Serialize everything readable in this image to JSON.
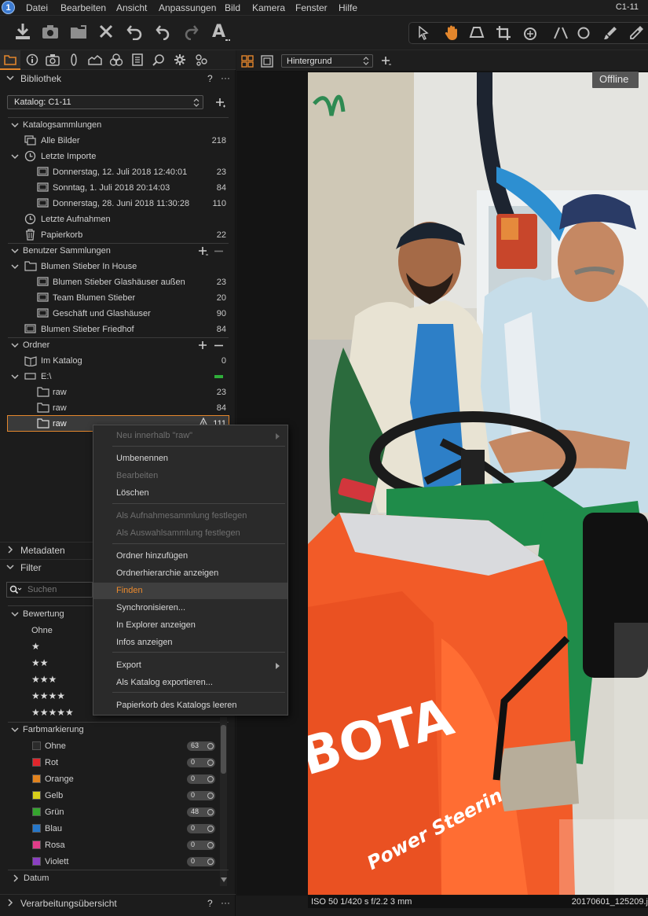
{
  "app": {
    "title": "C1-11"
  },
  "menubar": [
    "Datei",
    "Bearbeiten",
    "Ansicht",
    "Anpassungen",
    "Bild",
    "Kamera",
    "Fenster",
    "Hilfe"
  ],
  "library": {
    "title": "Bibliothek",
    "help": "?",
    "more": "···",
    "catalog_label": "Katalog: C1-11",
    "catalog_collections": {
      "title": "Katalogsammlungen",
      "items": [
        {
          "label": "Alle Bilder",
          "count": "218"
        },
        {
          "label": "Letzte Importe",
          "count": ""
        },
        {
          "label": "Donnerstag, 12. Juli 2018 12:40:01",
          "count": "23"
        },
        {
          "label": "Sonntag, 1. Juli 2018 20:14:03",
          "count": "84"
        },
        {
          "label": "Donnerstag, 28. Juni 2018 11:30:28",
          "count": "110"
        },
        {
          "label": "Letzte Aufnahmen",
          "count": ""
        },
        {
          "label": "Papierkorb",
          "count": "22"
        }
      ]
    },
    "user_collections": {
      "title": "Benutzer Sammlungen",
      "items": [
        {
          "label": "Blumen Stieber In House",
          "count": ""
        },
        {
          "label": "Blumen Stieber Glashäuser außen",
          "count": "23"
        },
        {
          "label": "Team Blumen Stieber",
          "count": "20"
        },
        {
          "label": "Geschäft und Glashäuser",
          "count": "90"
        },
        {
          "label": "Blumen Stieber Friedhof",
          "count": "84"
        }
      ]
    },
    "folders": {
      "title": "Ordner",
      "items": [
        {
          "label": "Im Katalog",
          "count": "0"
        },
        {
          "label": "E:\\",
          "count": ""
        },
        {
          "label": "raw",
          "count": "23"
        },
        {
          "label": "raw",
          "count": "84"
        },
        {
          "label": "raw",
          "count": "111"
        }
      ]
    }
  },
  "context_menu": [
    {
      "label": "Neu innerhalb \"raw\"",
      "disabled": true
    },
    {
      "label": "Umbenennen"
    },
    {
      "label": "Bearbeiten",
      "disabled": true
    },
    {
      "label": "Löschen"
    },
    {
      "label": "Als Aufnahmesammlung festlegen",
      "disabled": true
    },
    {
      "label": "Als Auswahlsammlung festlegen",
      "disabled": true
    },
    {
      "label": "Ordner hinzufügen"
    },
    {
      "label": "Ordnerhierarchie anzeigen"
    },
    {
      "label": "Finden",
      "highlighted": true
    },
    {
      "label": "Synchronisieren..."
    },
    {
      "label": "In Explorer anzeigen"
    },
    {
      "label": "Infos anzeigen"
    },
    {
      "label": "Export"
    },
    {
      "label": "Als Katalog exportieren..."
    },
    {
      "label": "Papierkorb des Katalogs leeren"
    }
  ],
  "metadata": {
    "title": "Metadaten"
  },
  "filter": {
    "title": "Filter",
    "search_placeholder": "Suchen",
    "rating": {
      "title": "Bewertung",
      "none": "Ohne"
    },
    "color_label": {
      "title": "Farbmarkierung",
      "items": [
        {
          "label": "Ohne",
          "count": "63",
          "color": "#2b2b2b"
        },
        {
          "label": "Rot",
          "count": "0",
          "color": "#e0262c"
        },
        {
          "label": "Orange",
          "count": "0",
          "color": "#e2831e"
        },
        {
          "label": "Gelb",
          "count": "0",
          "color": "#d8cf1a"
        },
        {
          "label": "Grün",
          "count": "48",
          "color": "#35a52e"
        },
        {
          "label": "Blau",
          "count": "0",
          "color": "#2677c9"
        },
        {
          "label": "Rosa",
          "count": "0",
          "color": "#e23c89"
        },
        {
          "label": "Violett",
          "count": "0",
          "color": "#8b3fc2"
        }
      ]
    },
    "date": "Datum"
  },
  "processing": {
    "title": "Verarbeitungsübersicht",
    "help": "?",
    "more": "···"
  },
  "viewer": {
    "background_label": "Hintergrund",
    "offline_badge": "Offline",
    "exif": "ISO 50  1/420 s  f/2.2  3 mm",
    "filename": "20170601_125209.j",
    "photo_text_brand": "BOTA",
    "photo_text_steering": "Power Steering"
  },
  "colors": {
    "accent": "#e3862c",
    "panel_bg": "#1c1c1c",
    "menu_bg": "#2a2a2a"
  }
}
